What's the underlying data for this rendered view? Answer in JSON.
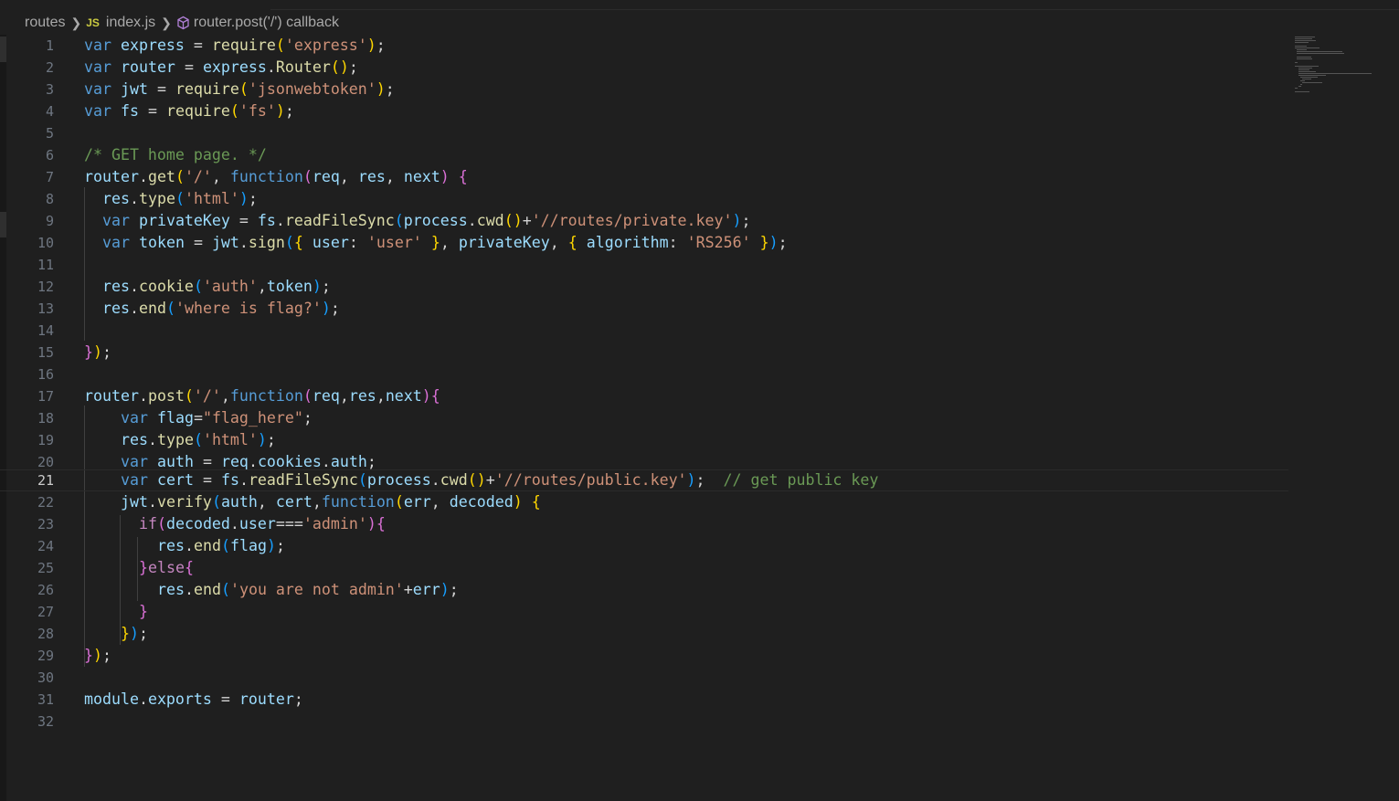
{
  "breadcrumb": {
    "folder": "routes",
    "file": "index.js",
    "file_icon": "JS",
    "symbol": "router.post('/') callback"
  },
  "editor": {
    "current_line": 21,
    "line_numbers": [
      "1",
      "2",
      "3",
      "4",
      "5",
      "6",
      "7",
      "8",
      "9",
      "10",
      "11",
      "12",
      "13",
      "14",
      "15",
      "16",
      "17",
      "18",
      "19",
      "20",
      "21",
      "22",
      "23",
      "24",
      "25",
      "26",
      "27",
      "28",
      "29",
      "30",
      "31",
      "32"
    ],
    "code_lines": [
      "var express = require('express');",
      "var router = express.Router();",
      "var jwt = require('jsonwebtoken');",
      "var fs = require('fs');",
      "",
      "/* GET home page. */",
      "router.get('/', function(req, res, next) {",
      "  res.type('html');",
      "  var privateKey = fs.readFileSync(process.cwd()+'//routes/private.key');",
      "  var token = jwt.sign({ user: 'user' }, privateKey, { algorithm: 'RS256' });",
      "",
      "  res.cookie('auth',token);",
      "  res.end('where is flag?');",
      "",
      "});",
      "",
      "router.post('/',function(req,res,next){",
      "    var flag=\"flag_here\";",
      "    res.type('html');",
      "    var auth = req.cookies.auth;",
      "    var cert = fs.readFileSync(process.cwd()+'//routes/public.key');  // get public key",
      "    jwt.verify(auth, cert,function(err, decoded) {",
      "      if(decoded.user==='admin'){",
      "        res.end(flag);",
      "      }else{",
      "        res.end('you are not admin'+err);",
      "      }",
      "    });",
      "});",
      "",
      "module.exports = router;",
      ""
    ]
  },
  "icons": {
    "chevron": "chevron-right-icon",
    "symbol": "symbol-method-icon"
  },
  "colors": {
    "background": "#1f1f1f",
    "keyword": "#569cd6",
    "string": "#ce9178",
    "function": "#dcdcaa",
    "variable": "#9cdcfe",
    "comment": "#6a9955",
    "control": "#c586c0"
  }
}
